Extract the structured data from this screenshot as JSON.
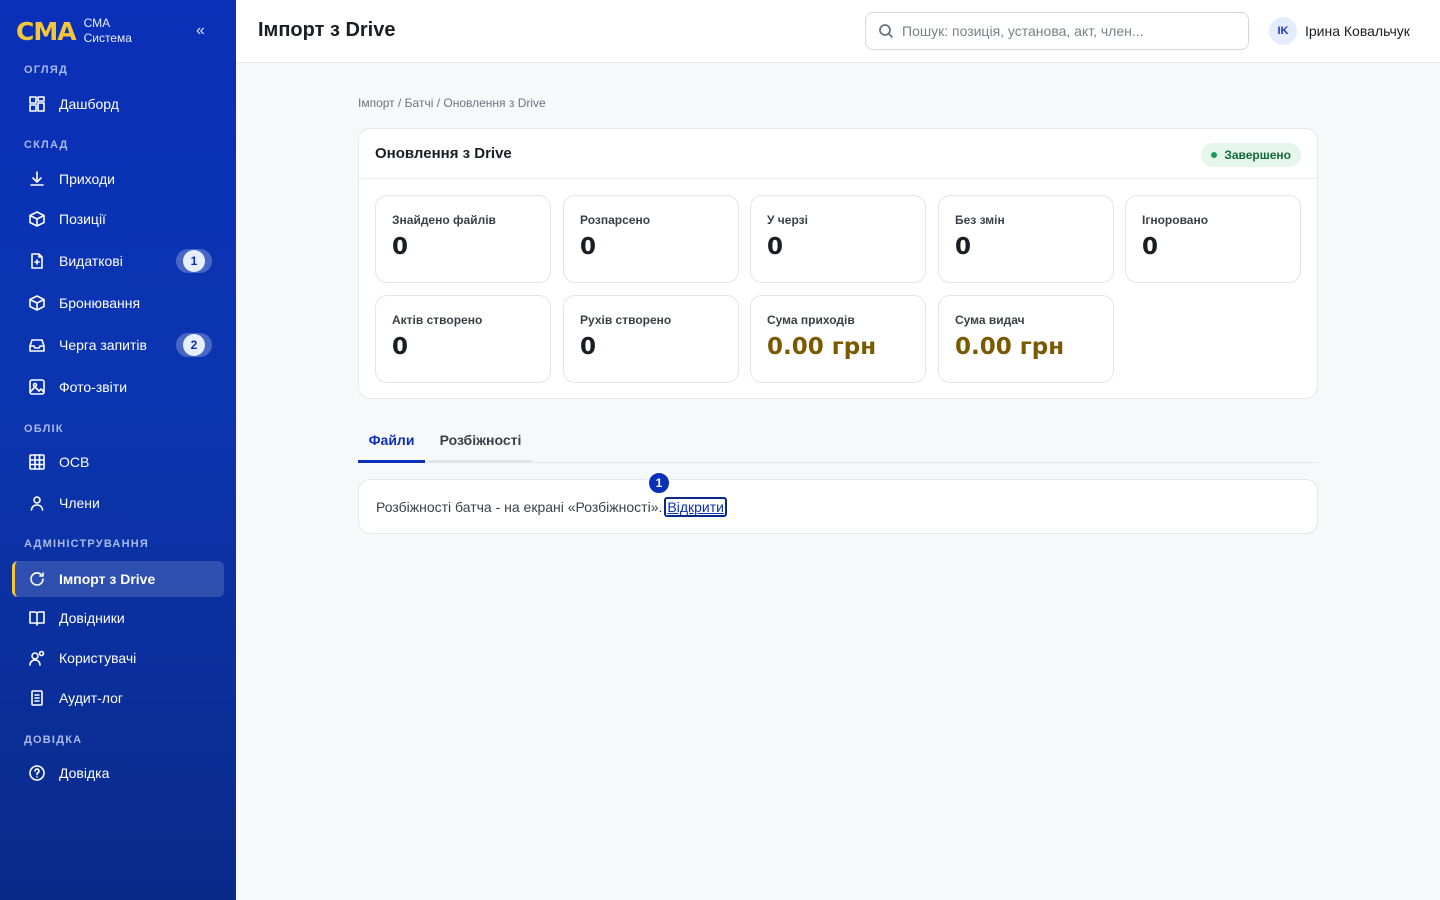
{
  "brand": {
    "logo": "СМА",
    "line1": "СМА",
    "line2": "Система",
    "collapse": "«"
  },
  "sidebar": {
    "sections": {
      "overview": "ОГЛЯД",
      "warehouse": "СКЛАД",
      "accounting": "ОБЛІК",
      "admin": "АДМІНІСТРУВАННЯ",
      "help": "ДОВІДКА"
    },
    "items": {
      "dashboard": "Дашборд",
      "incoming": "Приходи",
      "positions": "Позиції",
      "expenses": "Видаткові",
      "expenses_badge": "1",
      "reservations": "Бронювання",
      "requests": "Черга запитів",
      "requests_badge": "2",
      "photo_reports": "Фото-звіти",
      "osv": "ОСВ",
      "members": "Члени",
      "drive_import": "Імпорт з Drive",
      "directories": "Довідники",
      "users": "Користувачі",
      "audit": "Аудит-лог",
      "help": "Довідка"
    }
  },
  "header": {
    "title": "Імпорт з Drive",
    "search_placeholder": "Пошук: позиція, установа, акт, член...",
    "user_initials": "IK",
    "user_name": "Ірина Ковальчук"
  },
  "breadcrumb": "Імпорт / Батчі / Оновлення з Drive",
  "card": {
    "title": "Оновлення з Drive",
    "status": "Завершено",
    "status_color": "#1a9a55"
  },
  "stats": {
    "found": {
      "label": "Знайдено файлів",
      "value": "0"
    },
    "parsed": {
      "label": "Розпарсено",
      "value": "0"
    },
    "queued": {
      "label": "У черзі",
      "value": "0"
    },
    "unchanged": {
      "label": "Без змін",
      "value": "0"
    },
    "ignored": {
      "label": "Ігноровано",
      "value": "0"
    },
    "acts": {
      "label": "Актів створено",
      "value": "0"
    },
    "moves": {
      "label": "Рухів створено",
      "value": "0"
    },
    "income_sum": {
      "label": "Сума приходів",
      "value": "0.00 грн"
    },
    "issue_sum": {
      "label": "Сума видач",
      "value": "0.00 грн"
    }
  },
  "tabs": {
    "files": "Файли",
    "discrepancies": "Розбіжності"
  },
  "info": {
    "text": "Розбіжності батча - на екрані «Розбіжності».",
    "link": "Відкрити",
    "marker": "1"
  },
  "colors": {
    "sidebar": "#0a2fb8",
    "accent": "#f4c73a",
    "money": "#7a5a00"
  }
}
